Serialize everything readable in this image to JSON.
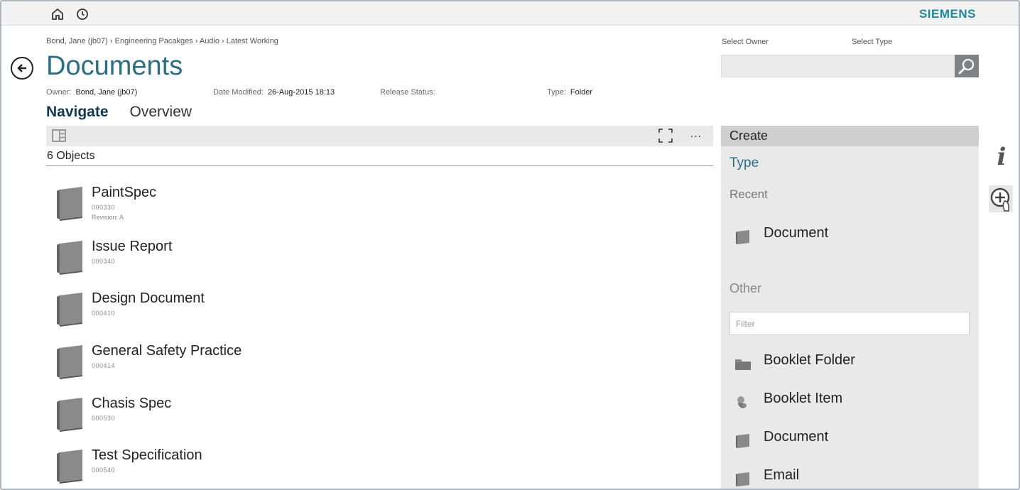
{
  "brand": "SIEMENS",
  "breadcrumb": "Bond, Jane (jb07) › Engineering Pacakges › Audio › Latest Working",
  "title": "Documents",
  "meta": {
    "owner_label": "Owner:",
    "owner_value": "Bond, Jane (jb07)",
    "modified_label": "Date Modified:",
    "modified_value": "26-Aug-2015 18:13",
    "release_label": "Release Status:",
    "release_value": "",
    "type_label": "Type:",
    "type_value": "Folder"
  },
  "tabs": [
    {
      "label": "Navigate",
      "active": true
    },
    {
      "label": "Overview",
      "active": false
    }
  ],
  "toolbar": {
    "more": "..."
  },
  "object_count": "6 Objects",
  "items": [
    {
      "name": "PaintSpec",
      "id": "000330",
      "rev": "Revision: A"
    },
    {
      "name": "Issue Report",
      "id": "000340",
      "rev": ""
    },
    {
      "name": "Design Document",
      "id": "000410",
      "rev": ""
    },
    {
      "name": "General Safety Practice",
      "id": "000414",
      "rev": ""
    },
    {
      "name": "Chasis Spec",
      "id": "000530",
      "rev": ""
    },
    {
      "name": "Test Specification",
      "id": "000540",
      "rev": ""
    }
  ],
  "search": {
    "owner_label": "Select Owner",
    "type_label": "Select Type",
    "value": ""
  },
  "create": {
    "header": "Create",
    "type_label": "Type",
    "recent_label": "Recent",
    "recent": [
      {
        "label": "Document",
        "icon": "document-icon"
      }
    ],
    "other_label": "Other",
    "filter_placeholder": "Filter",
    "other": [
      {
        "label": "Booklet Folder",
        "icon": "folder-icon"
      },
      {
        "label": "Booklet Item",
        "icon": "item-icon"
      },
      {
        "label": "Document",
        "icon": "document-icon"
      },
      {
        "label": "Email",
        "icon": "document-icon"
      }
    ]
  }
}
